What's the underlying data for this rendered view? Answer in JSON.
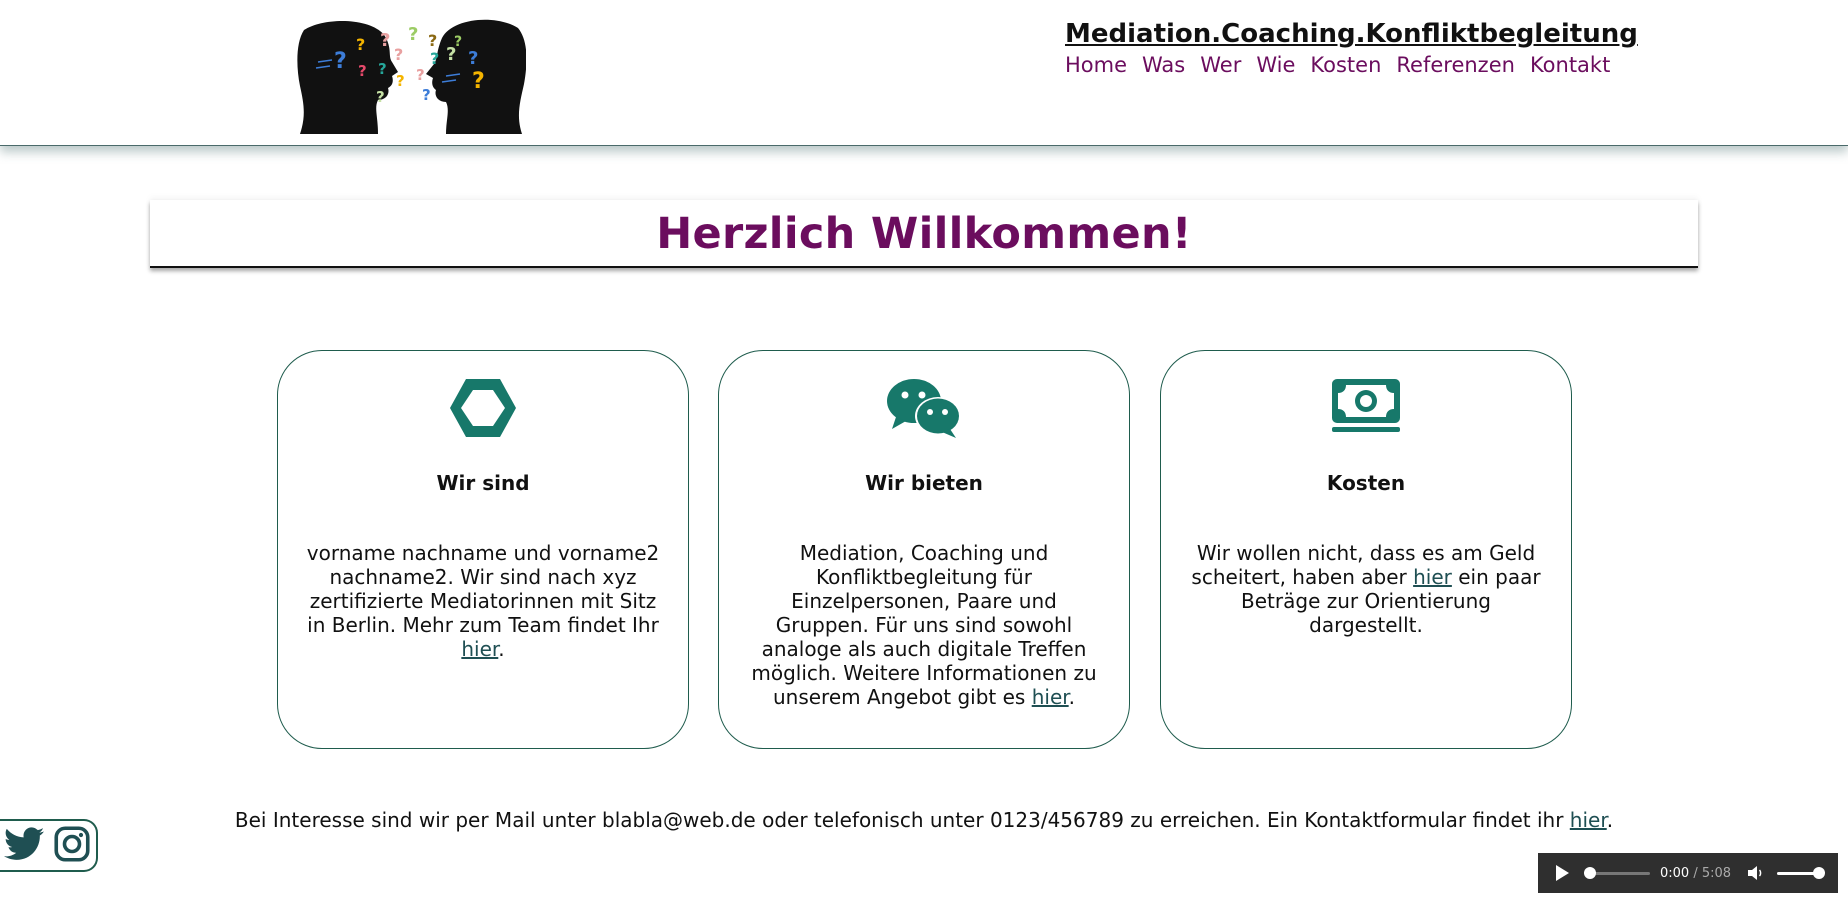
{
  "header": {
    "site_title": "Mediation.Coaching.Konfliktbegleitung",
    "nav": [
      "Home",
      "Was",
      "Wer",
      "Wie",
      "Kosten",
      "Referenzen",
      "Kontakt"
    ]
  },
  "welcome": {
    "title": "Herzlich Willkommen!"
  },
  "cards": [
    {
      "icon": "hexagon-icon",
      "title": "Wir sind",
      "text": "vorname nachname und vorname2 nachname2. Wir sind nach xyz zertifizierte Mediatorinnen mit Sitz in Berlin. Mehr zum Team findet Ihr ",
      "link": "hier",
      "after": "."
    },
    {
      "icon": "wechat-icon",
      "title": "Wir bieten",
      "text": "Mediation, Coaching und Konfliktbegleitung für Einzelpersonen, Paare und Gruppen. Für uns sind sowohl analoge als auch digitale Treffen möglich. Weitere Informationen zu unserem Angebot gibt es ",
      "link": "hier",
      "after": "."
    },
    {
      "icon": "money-bill-icon",
      "title": "Kosten",
      "text_before": "Wir wollen nicht, dass es am Geld scheitert, haben aber ",
      "link": "hier",
      "text_after": " ein paar Beträge zur Orientierung dargestellt."
    }
  ],
  "contact": {
    "text": "Bei Interesse sind wir per Mail unter blabla@web.de oder telefonisch unter 0123/456789 zu erreichen. Ein Kontaktformular findet ihr ",
    "link": "hier",
    "after": "."
  },
  "social": [
    "twitter-icon",
    "instagram-icon"
  ],
  "player": {
    "current": "0:00",
    "separator": " / ",
    "duration": "5:08"
  },
  "colors": {
    "accent": "#6b0d5e",
    "teal": "#17786a",
    "border": "#1f5c4d",
    "link": "#1f4f53"
  }
}
